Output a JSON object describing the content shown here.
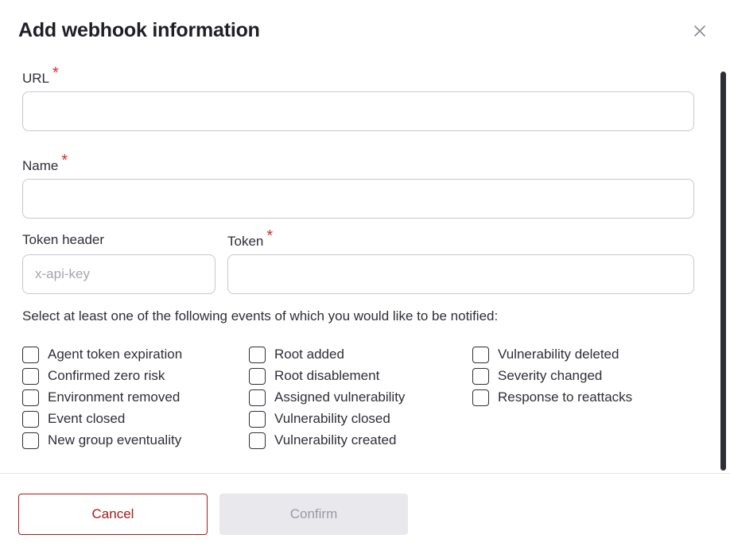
{
  "modal": {
    "title": "Add webhook information",
    "close_icon": "close-icon"
  },
  "form": {
    "url": {
      "label": "URL",
      "required_mark": "*",
      "value": "",
      "placeholder": ""
    },
    "name": {
      "label": "Name",
      "required_mark": "*",
      "value": "",
      "placeholder": ""
    },
    "token_header": {
      "label": "Token header",
      "value": "",
      "placeholder": "x-api-key"
    },
    "token": {
      "label": "Token",
      "required_mark": "*",
      "value": "",
      "placeholder": ""
    },
    "events_instruction": "Select at least one of the following events of which you would like to be notified:",
    "events": [
      {
        "label": "Agent token expiration",
        "checked": false
      },
      {
        "label": "Confirmed zero risk",
        "checked": false
      },
      {
        "label": "Environment removed",
        "checked": false
      },
      {
        "label": "Event closed",
        "checked": false
      },
      {
        "label": "New group eventuality",
        "checked": false
      },
      {
        "label": "Root added",
        "checked": false
      },
      {
        "label": "Root disablement",
        "checked": false
      },
      {
        "label": "Assigned vulnerability",
        "checked": false
      },
      {
        "label": "Vulnerability closed",
        "checked": false
      },
      {
        "label": "Vulnerability created",
        "checked": false
      },
      {
        "label": "Vulnerability deleted",
        "checked": false
      },
      {
        "label": "Severity changed",
        "checked": false
      },
      {
        "label": "Response to reattacks",
        "checked": false
      }
    ]
  },
  "footer": {
    "cancel_label": "Cancel",
    "confirm_label": "Confirm",
    "confirm_disabled": true
  },
  "colors": {
    "required": "#d52c2c",
    "cancel_border": "#a61c1c",
    "confirm_disabled_bg": "#e8e8ed"
  }
}
